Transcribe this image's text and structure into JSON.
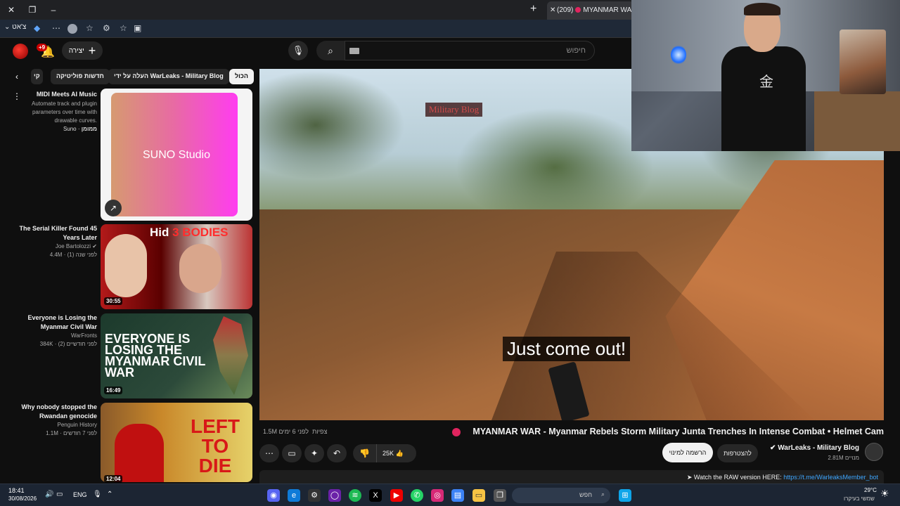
{
  "browser": {
    "tab_title": "MYANMAR WAR - M",
    "tab_count": "(209)",
    "chat_label": "צ'אט"
  },
  "youtube": {
    "create_label": "יצירה",
    "notifications_badge": "+9",
    "search_placeholder": "חיפוש",
    "chips": [
      "הכול",
      "העלה על ידי WarLeaks - Military Blog",
      "חדשות פוליטיקה",
      "קי"
    ],
    "recommendations": [
      {
        "title": "MIDI Meets AI Music",
        "description": "Automate track and plugin parameters over time with drawable curves.",
        "channel": "Suno",
        "meta": "ממומן",
        "thumb_text": "SUNO Studio"
      },
      {
        "title": "The Serial Killer Found 45 Years Later",
        "channel": "Joe Bartolozzi",
        "views": "4.4M",
        "age": "לפני שנה (1)",
        "duration": "30:55",
        "thumb_text_a": "Hid",
        "thumb_text_b": "3 BODIES"
      },
      {
        "title": "Everyone is Losing the Myanmar Civil War",
        "channel": "WarFronts",
        "views": "384K",
        "age": "לפני חודשיים (2)",
        "duration": "16:49",
        "thumb_text": "EVERYONE IS LOSING THE MYANMAR CIVIL WAR"
      },
      {
        "title": "Why nobody stopped the Rwandan genocide",
        "channel": "Penguin History",
        "views": "1.1M",
        "age": "לפני 7 חודשים",
        "duration": "12:04",
        "thumb_text": "LEFT TO DIE"
      }
    ],
    "player": {
      "watermark": "Military Blog",
      "caption": "Just come out!"
    },
    "video": {
      "title": "MYANMAR WAR - Myanmar Rebels Storm Military Junta Trenches In Intense Combat • Helmet Cam",
      "views": "1.5M צפיות",
      "age": "לפני 6 ימים",
      "likes": "25K",
      "channel": "WarLeaks - Military Blog",
      "subscribers": "2.81M מנויים",
      "join_label": "להצטרפות",
      "subscribe_label": "הרשמה למינוי",
      "description_prefix": "➤ Watch the RAW version HERE:",
      "description_link": "https://t.me/WarleaksMember_bot"
    }
  },
  "taskbar": {
    "time": "18:41",
    "date": "30/08/2026",
    "lang": "ENG",
    "search_label": "חפש",
    "weather_temp": "29°C",
    "weather_desc": "שמשי בעיקרו"
  },
  "colors": {
    "accent": "#e0245e",
    "link": "#3ea6ff",
    "bg": "#0f0f0f"
  }
}
